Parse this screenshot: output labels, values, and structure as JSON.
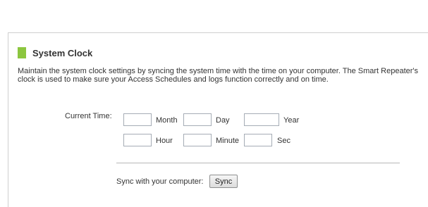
{
  "section": {
    "title": "System Clock",
    "description": "Maintain the system clock settings by syncing the system time with the time on your computer. The Smart Repeater's clock is used to make sure your Access Schedules and logs function correctly and on time."
  },
  "current_time": {
    "label": "Current Time:",
    "fields": {
      "month": {
        "caption": "Month",
        "value": ""
      },
      "day": {
        "caption": "Day",
        "value": ""
      },
      "year": {
        "caption": "Year",
        "value": ""
      },
      "hour": {
        "caption": "Hour",
        "value": ""
      },
      "minute": {
        "caption": "Minute",
        "value": ""
      },
      "sec": {
        "caption": "Sec",
        "value": ""
      }
    }
  },
  "sync": {
    "label": "Sync with your computer:",
    "button_label": "Sync"
  },
  "colors": {
    "accent_green": "#8cc63f"
  }
}
